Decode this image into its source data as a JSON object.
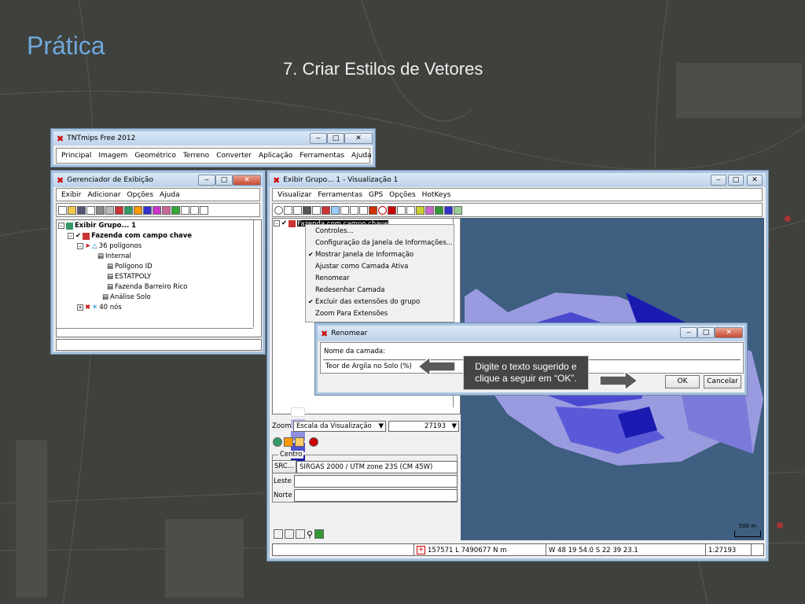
{
  "slide": {
    "title": "Prática",
    "subtitle": "7. Criar Estilos de Vetores"
  },
  "main_window": {
    "title": "TNTmips Free 2012",
    "menu": [
      "Principal",
      "Imagem",
      "Geométrico",
      "Terreno",
      "Converter",
      "Aplicação",
      "Ferramentas",
      "Ajuda"
    ]
  },
  "display_manager": {
    "title": "Gerenciador de Exibição",
    "menu": [
      "Exibir",
      "Adicionar",
      "Opções",
      "Ajuda"
    ],
    "tree": [
      {
        "label": "Exibir Grupo... 1",
        "bold": true
      },
      {
        "label": "Fazenda com campo chave",
        "bold": true
      },
      {
        "label": "36 polígonos",
        "bold": false
      },
      {
        "label": "Internal",
        "bold": false
      },
      {
        "label": "Polígono ID",
        "bold": false
      },
      {
        "label": "ESTATPOLY",
        "bold": false
      },
      {
        "label": "Fazenda Barreiro Rico",
        "bold": false
      },
      {
        "label": "Análise Solo",
        "bold": false
      },
      {
        "label": "40 nós",
        "bold": false
      }
    ]
  },
  "view_window": {
    "title": "Exibir Grupo... 1 - Visualização 1",
    "menu": [
      "Visualizar",
      "Ferramentas",
      "GPS",
      "Opções",
      "HotKeys"
    ],
    "layer_label": "Fazenda com campo chave",
    "context_menu": [
      "Controles...",
      "Configuração da Janela de Informações...",
      "Mostrar Janela de Informação",
      "Ajustar como Camada Ativa",
      "Renomear",
      "Redesenhar Camada",
      "Excluir das extensões do grupo",
      "Zoom Para Extensões"
    ],
    "zoom_label": "Zoom",
    "zoom_mode": "Escala da Visualização",
    "zoom_value": "27193",
    "center_label": "Centro",
    "src_label": "SRC...",
    "src_value": "SIRGAS 2000 / UTM zone 23S (CM 45W)",
    "east_label": "Leste",
    "north_label": "Norte",
    "scale_bar": "500 m",
    "status": {
      "coords": "157571 L 7490677 N m",
      "latlon": "W 48 19 54.0  S 22 39 23.1",
      "scale": "1:27193"
    }
  },
  "rename_dialog": {
    "title": "Renomear",
    "field_label": "Nome da camada:",
    "field_value": "Teor de Argila no Solo (%)",
    "ok": "OK",
    "cancel": "Cancelar"
  },
  "callout": {
    "line1": "Digite o texto sugerido e",
    "line2": "clique a seguir em “OK”."
  },
  "colors": {
    "title_blue": "#6fa8dc",
    "map_bg": "#3e5f80",
    "poly_dark": "#1a1ab0",
    "poly_mid": "#4a4ad0",
    "poly_light": "#9a9ae0"
  }
}
